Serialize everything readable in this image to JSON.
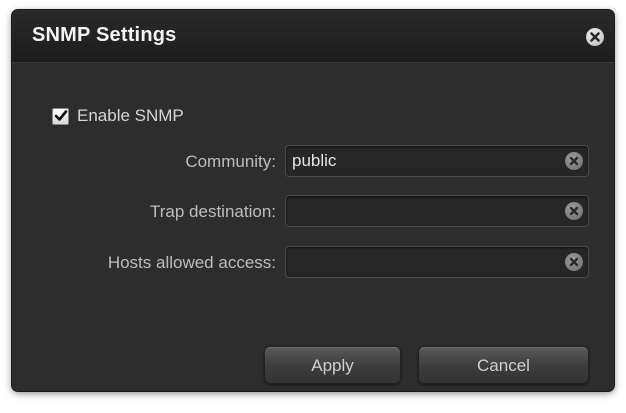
{
  "dialog": {
    "title": "SNMP Settings",
    "close_icon": "close-circle-icon"
  },
  "enable_snmp": {
    "label": "Enable SNMP",
    "checked": true
  },
  "fields": {
    "community": {
      "label": "Community:",
      "value": "public",
      "clear_icon": "clear-circle-icon"
    },
    "trap_destination": {
      "label": "Trap destination:",
      "value": "",
      "clear_icon": "clear-circle-icon"
    },
    "hosts_allowed": {
      "label": "Hosts allowed access:",
      "value": "",
      "clear_icon": "clear-circle-icon"
    }
  },
  "buttons": {
    "apply": "Apply",
    "cancel": "Cancel"
  }
}
